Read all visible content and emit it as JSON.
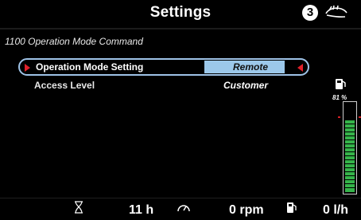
{
  "header": {
    "title": "Settings",
    "badge": "3"
  },
  "section_title": "1100 Operation Mode Command",
  "settings": [
    {
      "label": "Operation Mode Setting",
      "value": "Remote"
    },
    {
      "label": "Access Level",
      "value": "Customer"
    }
  ],
  "fuel": {
    "percent_label": "81 %",
    "level_fraction": 0.81
  },
  "status": {
    "hours": "11 h",
    "rpm": "0 rpm",
    "rate": "0 l/h"
  },
  "colors": {
    "selection": "#9cc8ea",
    "arrow": "#e0202a",
    "gauge_fill": "#35b44a"
  },
  "icons": {
    "hand": "hand-icon",
    "hourglass": "hourglass-icon",
    "speedometer": "speedometer-icon",
    "fuel": "fuel-pump-icon"
  }
}
